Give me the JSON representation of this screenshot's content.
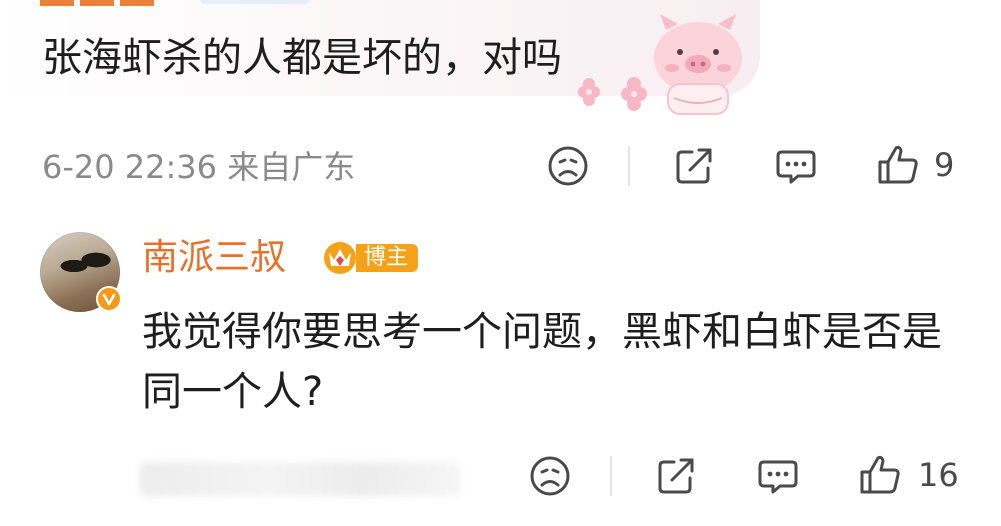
{
  "top_comment": {
    "text": "张海虾杀的人都是坏的，对吗",
    "meta": "6-20 22:36 来自广东",
    "likes": "9",
    "icons": [
      "sad-face-icon",
      "share-icon",
      "comment-icon",
      "thumbs-up-icon"
    ]
  },
  "reply": {
    "username": "南派三叔",
    "badge_label": "博主",
    "text": "我觉得你要思考一个问题，黑虾和白虾是否是同一个人?",
    "likes": "16",
    "icons": [
      "sad-face-icon",
      "share-icon",
      "comment-icon",
      "thumbs-up-icon"
    ]
  },
  "colors": {
    "username": "#e8702a",
    "badge": "#f5a21b",
    "meta": "#8a8a8a",
    "icon": "#4a4a4a"
  }
}
